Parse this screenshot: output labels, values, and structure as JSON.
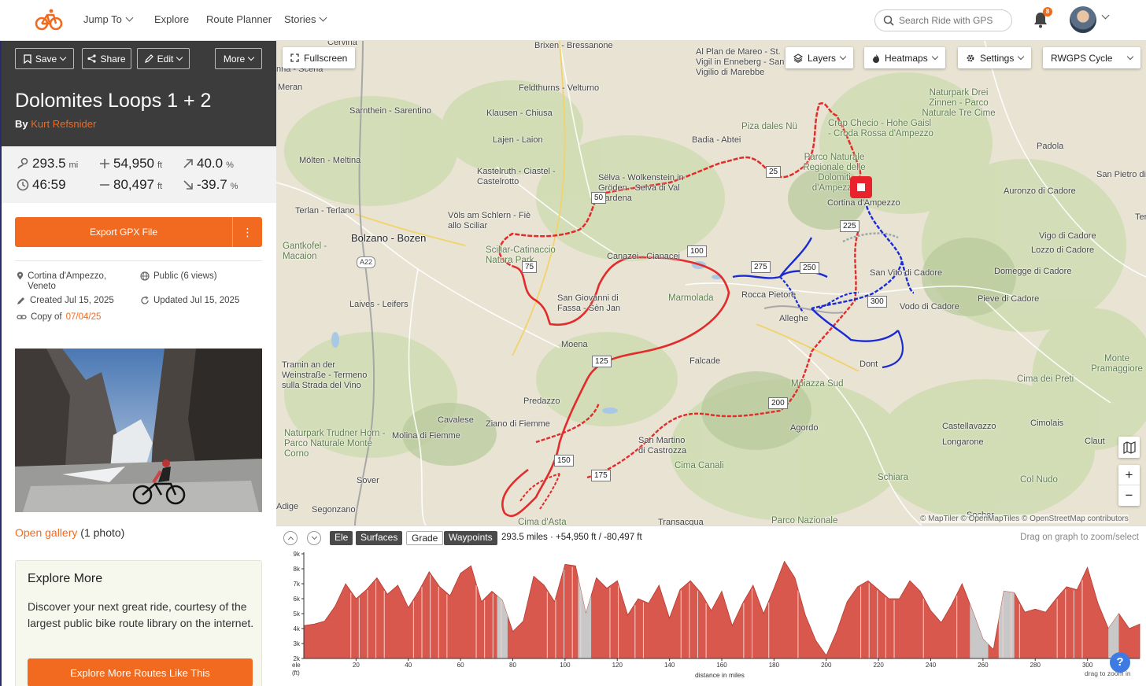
{
  "nav": {
    "items": [
      {
        "label": "Jump To",
        "dropdown": true
      },
      {
        "label": "Explore",
        "dropdown": false
      },
      {
        "label": "Route Planner",
        "dropdown": false
      },
      {
        "label": "Stories",
        "dropdown": true
      }
    ],
    "search_placeholder": "Search Ride with GPS",
    "notification_count": "8",
    "accent": "#f26a1f"
  },
  "route": {
    "actions": {
      "save": "Save",
      "share": "Share",
      "edit": "Edit",
      "more": "More"
    },
    "title": "Dolomites Loops 1 + 2",
    "by_label": "By",
    "author": "Kurt Refsnider",
    "stats": {
      "distance": "293.5",
      "distance_unit": "mi",
      "gain": "54,950",
      "gain_unit": "ft",
      "max_grade": "40.0",
      "max_grade_unit": "%",
      "time": "46:59",
      "loss": "80,497",
      "loss_unit": "ft",
      "min_grade": "-39.7",
      "min_grade_unit": "%"
    },
    "export_label": "Export GPX File",
    "export_more": "⋮",
    "location": "Cortina d'Ampezzo, Veneto",
    "visibility": "Public (6 views)",
    "created": "Created Jul 15, 2025",
    "updated": "Updated Jul 15, 2025",
    "copy_label": "Copy of",
    "copy_of": "07/04/25",
    "gallery_link": "Open gallery",
    "gallery_count": "(1 photo)"
  },
  "explore": {
    "title": "Explore More",
    "text": "Discover your next great ride, courtesy of the largest public bike route library on the internet.",
    "button": "Explore More Routes Like This"
  },
  "map": {
    "fullscreen": "Fullscreen",
    "layers": "Layers",
    "heatmaps": "Heatmaps",
    "settings": "Settings",
    "style": "RWGPS Cycle",
    "attribution": "© MapTiler © OpenMapTiles © OpenStreetMap contributors",
    "places": [
      "Cervina",
      "nna - Scena",
      "Meran",
      "Brixen - Bressanone",
      "Feldthurns - Velturno",
      "Klausen - Chiusa",
      "Sarnthein - Sarentino",
      "Lajen - Laion",
      "Mölten - Meltina",
      "Kastelruth - Ciastel - Castelrotto",
      "Sëlva - Wolkenstein in Gröden - Selva di Val Gardena",
      "Völs am Schlern - Fiè allo Sciliar",
      "Terlan - Terlano",
      "Bolzano - Bozen",
      "Gantkofel - Macaion",
      "A22",
      "Sciliar-Catinaccio Natura Park",
      "Laives - Leifers",
      "Canazei - Cianacei",
      "San Giovanni di Fassa - Sèn Jan",
      "Moena",
      "Marmolada",
      "Rocca Pietore",
      "Alleghe",
      "Falcade",
      "Predazzo",
      "Cavalese",
      "Ziano di Fiemme",
      "Molina di Fiemme",
      "Tramin an der Weinstraße - Termeno sulla Strada del Vino",
      "Naturpark Trudner Horn - Parco Naturale Monte Corno",
      "Sover",
      "Adige",
      "Segonzano",
      "San Martino di Castrozza",
      "Cima Canali",
      "Cima d'Asta",
      "Transacqua",
      "Moiazza Sud",
      "Agordo",
      "Schiara",
      "Parco Nazionale",
      "Socher",
      "Dont",
      "Vodo di Cadore",
      "San Vito di Cadore",
      "Cortina d'Ampezzo",
      "Piza dales Nü",
      "Badia - Abtei",
      "Al Plan de Mareo - St. Vigil in Enneberg - San Vigilio di Marebbe",
      "Crep Checio - Hohe Gaisl - Croda Rossa d'Ampezzo",
      "Parco Naturale Regionale delle Dolomiti d'Ampezzo",
      "Naturpark Drei Zinnen - Parco Naturale Tre Cime",
      "Padola",
      "San Pietro di",
      "Auronzo di Cadore",
      "Vigo di Cadore",
      "Lozzo di Cadore",
      "Domegge di Cadore",
      "Pieve di Cadore",
      "Monte Pramaggiore",
      "Cima dei Preti",
      "Castellavazzo",
      "Longarone",
      "Cimolais",
      "Claut",
      "Col Nudo",
      "Ter"
    ],
    "km_markers": [
      "25",
      "50",
      "75",
      "100",
      "125",
      "150",
      "175",
      "200",
      "225",
      "250",
      "275",
      "300"
    ]
  },
  "elevation": {
    "tabs": [
      {
        "label": "Ele",
        "active": true
      },
      {
        "label": "Surfaces",
        "active": true
      },
      {
        "label": "Grade",
        "active": false
      },
      {
        "label": "Waypoints",
        "active": true
      }
    ],
    "summary": "293.5 miles · +54,950 ft / -80,497 ft",
    "hint": "Drag on graph to zoom/select",
    "y_label": "ele (ft)",
    "x_label": "distance in miles",
    "drag_hint": "drag to zoom in",
    "help": "?"
  },
  "chart_data": {
    "type": "area",
    "title": "",
    "xlabel": "distance in miles",
    "ylabel": "ele (ft)",
    "xlim": [
      0,
      320
    ],
    "ylim": [
      2000,
      9000
    ],
    "x_ticks": [
      20,
      40,
      60,
      80,
      100,
      120,
      140,
      160,
      180,
      200,
      220,
      240,
      260,
      280,
      300
    ],
    "y_ticks": [
      "2k",
      "3k",
      "4k",
      "5k",
      "6k",
      "7k",
      "8k",
      "9k"
    ],
    "series": [
      {
        "color": "#d9584d",
        "x": [
          0,
          4,
          8,
          12,
          16,
          20,
          24,
          28,
          32,
          36,
          40,
          44,
          48,
          52,
          56,
          60,
          64,
          68,
          72,
          76,
          80,
          84,
          88,
          92,
          96,
          100,
          104,
          108,
          112,
          116,
          120,
          124,
          128,
          132,
          136,
          140,
          144,
          148,
          152,
          156,
          160,
          164,
          168,
          172,
          176,
          180,
          184,
          188,
          192,
          196,
          200,
          204,
          208,
          212,
          216,
          220,
          224,
          228,
          232,
          236,
          240,
          244,
          248,
          252,
          256,
          260,
          264,
          268,
          272,
          276,
          280,
          284,
          288,
          292,
          296,
          300,
          304,
          308,
          312,
          316,
          320
        ],
        "y": [
          4200,
          4300,
          4500,
          5500,
          7000,
          6000,
          6600,
          7400,
          6300,
          6900,
          5400,
          6500,
          7800,
          6800,
          6200,
          7700,
          8200,
          5800,
          6500,
          5900,
          3800,
          4500,
          7500,
          6900,
          5800,
          8300,
          8200,
          5000,
          7400,
          6700,
          7200,
          4900,
          6000,
          5700,
          6900,
          4700,
          6600,
          7200,
          6400,
          5200,
          6500,
          4200,
          5700,
          6900,
          5000,
          6700,
          8500,
          7400,
          4900,
          3200,
          2200,
          3800,
          5800,
          6800,
          7200,
          6600,
          6000,
          6000,
          7200,
          6500,
          5200,
          4400,
          5600,
          7000,
          5200,
          3300,
          2600,
          6500,
          6400,
          5100,
          5300,
          5100,
          6000,
          6800,
          6600,
          8100,
          5700,
          4000,
          5000,
          4000,
          4300
        ]
      }
    ],
    "unpaved_ranges": [
      [
        74,
        78
      ],
      [
        105,
        110
      ],
      [
        255,
        262
      ],
      [
        266,
        272
      ],
      [
        308,
        312
      ]
    ],
    "unpaved_color": "#c8c8c8",
    "grid": false
  }
}
